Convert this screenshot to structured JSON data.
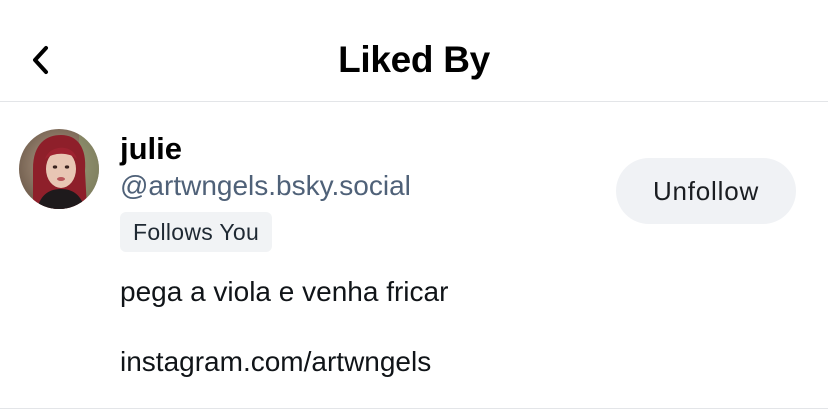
{
  "header": {
    "title": "Liked By",
    "back_icon": "chevron-left-icon"
  },
  "users": [
    {
      "display_name": "julie",
      "handle": "@artwngels.bsky.social",
      "follows_you_label": "Follows You",
      "action_label": "Unfollow",
      "bio_lines": [
        "pega a viola e venha fricar",
        "",
        "instagram.com/artwngels"
      ]
    }
  ]
}
